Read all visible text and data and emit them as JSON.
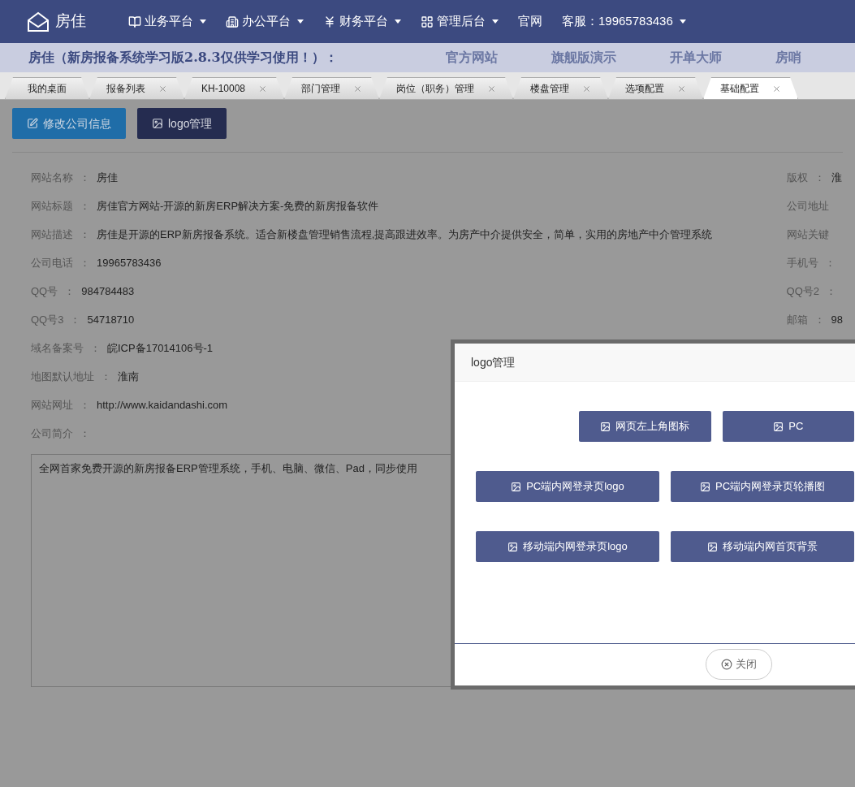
{
  "brand": {
    "name": "房佳"
  },
  "nav": [
    {
      "label": "业务平台",
      "kind": "menu"
    },
    {
      "label": "办公平台",
      "kind": "menu"
    },
    {
      "label": "财务平台",
      "kind": "menu"
    },
    {
      "label": "管理后台",
      "kind": "menu"
    },
    {
      "label": "官网",
      "kind": "link"
    },
    {
      "label": "客服：19965783436",
      "kind": "service"
    }
  ],
  "banner": {
    "title": "房佳（新房报备系统学习版2.8.3仅供学习使用！）：",
    "links": [
      "官方网站",
      "旗舰版演示",
      "开单大师",
      "房哨"
    ]
  },
  "tabs": [
    {
      "label": "我的桌面",
      "closable": false,
      "selected": false
    },
    {
      "label": "报备列表",
      "closable": true,
      "selected": false
    },
    {
      "label": "KH-10008",
      "closable": true,
      "selected": false
    },
    {
      "label": "部门管理",
      "closable": true,
      "selected": false
    },
    {
      "label": "岗位（职务）管理",
      "closable": true,
      "selected": false
    },
    {
      "label": "楼盘管理",
      "closable": true,
      "selected": false
    },
    {
      "label": "选项配置",
      "closable": true,
      "selected": false
    },
    {
      "label": "基础配置",
      "closable": true,
      "selected": true
    }
  ],
  "toolbar": [
    {
      "label": "修改公司信息",
      "kind": "edit"
    },
    {
      "label": "logo管理",
      "kind": "image"
    }
  ],
  "fields_left": [
    {
      "label": "网站名称",
      "colon": "：",
      "value": "房佳"
    },
    {
      "label": "网站标题",
      "colon": "：",
      "value": "房佳官方网站-开源的新房ERP解决方案-免费的新房报备软件"
    },
    {
      "label": "网站描述",
      "colon": "：",
      "value": "房佳是开源的ERP新房报备系统。适合新楼盘管理销售流程,提高跟进效率。为房产中介提供安全，简单，实用的房地产中介管理系统"
    },
    {
      "label": "公司电话",
      "colon": "：",
      "value": "19965783436"
    },
    {
      "label": "QQ号",
      "colon": "：",
      "value": "984784483"
    },
    {
      "label": "QQ号3",
      "colon": "：",
      "value": "54718710"
    },
    {
      "label": "域名备案号",
      "colon": "：",
      "value": "皖ICP备17014106号-1"
    },
    {
      "label": "地图默认地址",
      "colon": "：",
      "value": "淮南"
    },
    {
      "label": "网站网址",
      "colon": "：",
      "value": "http://www.kaidandashi.com"
    },
    {
      "label": "公司简介",
      "colon": "："
    }
  ],
  "intro_text": "全网首家免费开源的新房报备ERP管理系统，手机、电脑、微信、Pad，同步使用",
  "fields_right": [
    {
      "label": "版权",
      "colon": "：",
      "value": "淮"
    },
    {
      "label": "公司地址"
    },
    {
      "label": "网站关键"
    },
    {
      "label": "手机号",
      "colon": "："
    },
    {
      "label": "QQ号2",
      "colon": "："
    },
    {
      "label": "邮箱",
      "colon": "：",
      "value": "98"
    }
  ],
  "dialog": {
    "title": "logo管理",
    "rows": [
      [
        "网页左上角图标",
        "PC"
      ],
      [
        "PC端内网登录页logo",
        "PC端内网登录页轮播图"
      ],
      [
        "移动端内网登录页logo",
        "移动端内网首页背景"
      ]
    ],
    "close": "关闭"
  }
}
